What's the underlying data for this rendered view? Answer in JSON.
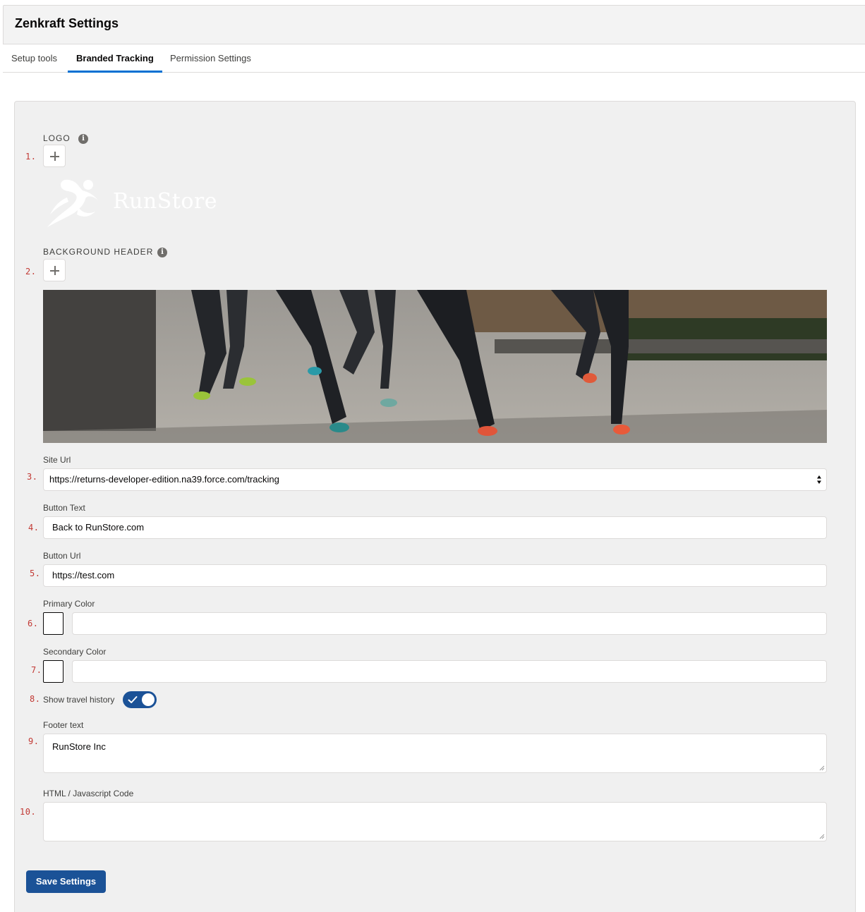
{
  "header": {
    "title": "Zenkraft Settings"
  },
  "tabs": [
    {
      "label": "Setup tools",
      "active": false
    },
    {
      "label": "Branded Tracking",
      "active": true
    },
    {
      "label": "Permission Settings",
      "active": false
    }
  ],
  "markers": [
    "1.",
    "2.",
    "3.",
    "4.",
    "5.",
    "6.",
    "7.",
    "8.",
    "9.",
    "10."
  ],
  "logo": {
    "label": "LOGO",
    "brand_text": "RunStore",
    "info_icon": "info-icon",
    "add_icon": "plus-icon"
  },
  "background_header": {
    "label": "BACKGROUND HEADER",
    "info_icon": "info-icon",
    "add_icon": "plus-icon"
  },
  "site_url": {
    "label": "Site Url",
    "value": "https://returns-developer-edition.na39.force.com/tracking"
  },
  "button_text": {
    "label": "Button Text",
    "value": "Back to RunStore.com"
  },
  "button_url": {
    "label": "Button Url",
    "value": "https://test.com"
  },
  "primary_color": {
    "label": "Primary Color",
    "value": ""
  },
  "secondary_color": {
    "label": "Secondary Color",
    "value": ""
  },
  "travel_history": {
    "label": "Show travel history",
    "checked": true
  },
  "footer_text": {
    "label": "Footer text",
    "value": "RunStore Inc"
  },
  "html_code": {
    "label": "HTML / Javascript Code",
    "value": ""
  },
  "actions": {
    "save_label": "Save Settings"
  },
  "colors": {
    "brand": "#1b5297",
    "tab_active": "#0070d2",
    "marker": "#c23934"
  }
}
